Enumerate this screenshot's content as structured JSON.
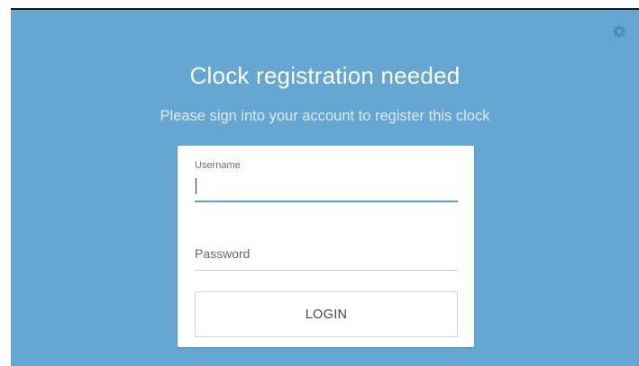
{
  "screen": {
    "title": "Clock registration needed",
    "subtitle": "Please sign into your account to register this clock",
    "background_color": "#66a6d2",
    "settings_icon": "gear-icon"
  },
  "login_form": {
    "username": {
      "label": "Username",
      "value": ""
    },
    "password": {
      "placeholder": "Password",
      "value": ""
    },
    "login_label": "LOGIN",
    "accent_color": "#5e9ed0"
  }
}
